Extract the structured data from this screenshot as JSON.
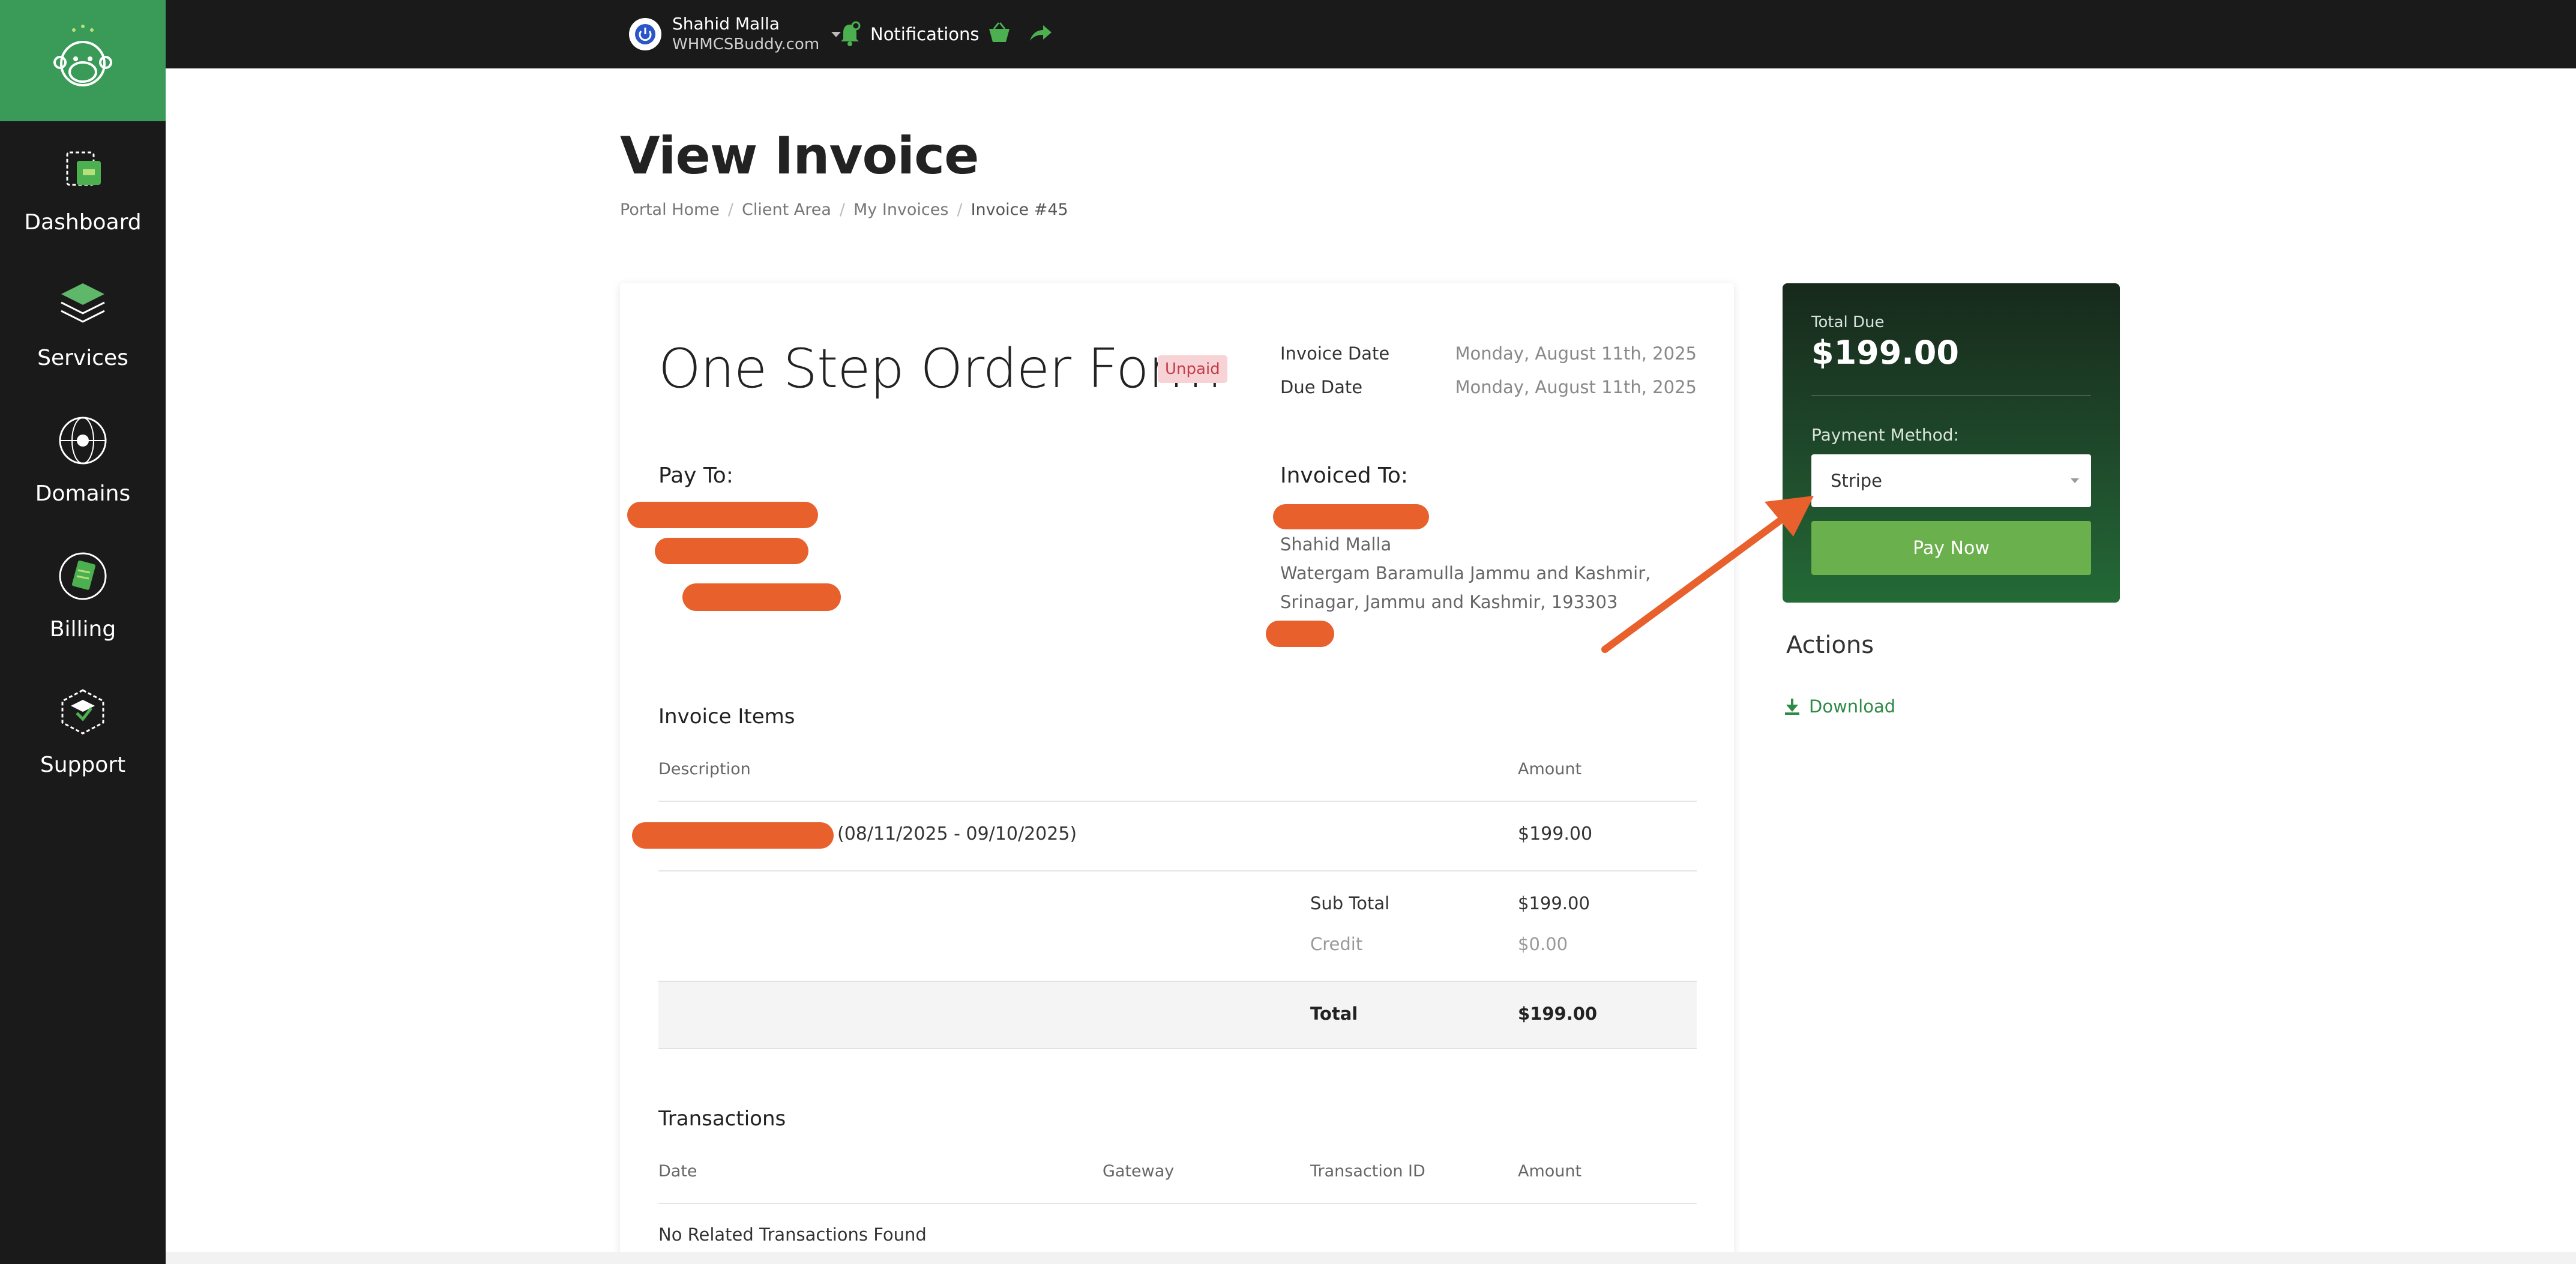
{
  "sidebar": {
    "items": [
      {
        "label": "Dashboard",
        "icon": "dashboard-icon"
      },
      {
        "label": "Services",
        "icon": "services-icon"
      },
      {
        "label": "Domains",
        "icon": "domains-icon"
      },
      {
        "label": "Billing",
        "icon": "billing-icon"
      },
      {
        "label": "Support",
        "icon": "support-icon"
      }
    ]
  },
  "topbar": {
    "user_name": "Shahid Malla",
    "user_domain": "WHMCSBuddy.com",
    "notifications_label": "Notifications"
  },
  "page": {
    "title": "View Invoice",
    "breadcrumb": [
      "Portal Home",
      "Client Area",
      "My Invoices",
      "Invoice #45"
    ]
  },
  "invoice": {
    "title": "One Step Order Form",
    "status": "Unpaid",
    "invoice_date_label": "Invoice Date",
    "invoice_date": "Monday, August 11th, 2025",
    "due_date_label": "Due Date",
    "due_date": "Monday, August 11th, 2025",
    "pay_to_label": "Pay To:",
    "invoiced_to_label": "Invoiced To:",
    "invoiced_to": {
      "name": "Shahid Malla",
      "line1": "Watergam Baramulla Jammu and Kashmir,",
      "line2": "Srinagar, Jammu and Kashmir, 193303"
    },
    "items_heading": "Invoice Items",
    "col_description": "Description",
    "col_amount": "Amount",
    "item": {
      "description_suffix": "(08/11/2025 - 09/10/2025)",
      "amount": "$199.00"
    },
    "subtotal_label": "Sub Total",
    "subtotal": "$199.00",
    "credit_label": "Credit",
    "credit": "$0.00",
    "total_label": "Total",
    "total": "$199.00",
    "transactions_heading": "Transactions",
    "tx_cols": {
      "date": "Date",
      "gateway": "Gateway",
      "id": "Transaction ID",
      "amount": "Amount"
    },
    "tx_empty": "No Related Transactions Found"
  },
  "payment_panel": {
    "total_due_label": "Total Due",
    "total_due": "$199.00",
    "method_label": "Payment Method:",
    "method_value": "Stripe",
    "pay_button": "Pay Now"
  },
  "actions": {
    "heading": "Actions",
    "download_label": "Download"
  },
  "colors": {
    "brand_green": "#3a9a57",
    "button_green": "#6ab04c",
    "sidebar_dark": "#1a1a1a",
    "annotation_orange": "#e8602c",
    "unpaid_badge_bg": "#f7d3d6",
    "unpaid_badge_text": "#c43b4a"
  }
}
